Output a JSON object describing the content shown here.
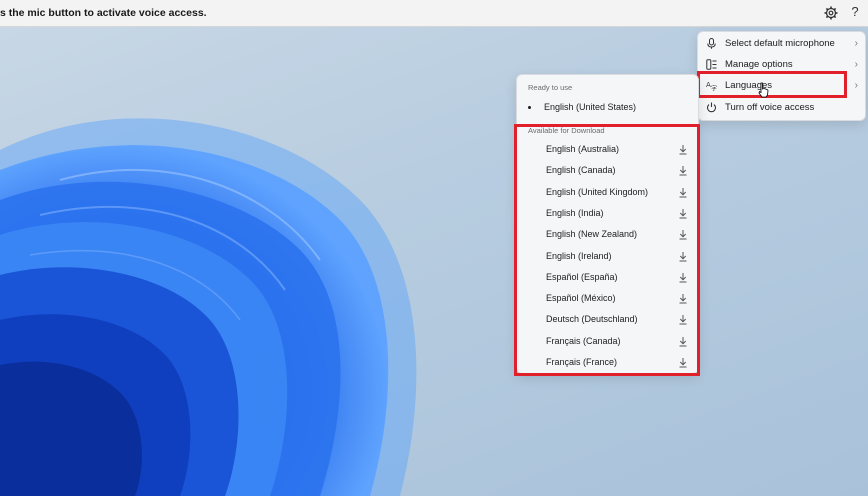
{
  "topbar": {
    "message": "s the mic button to activate voice access.",
    "gear_icon": "gear-icon",
    "help_label": "?"
  },
  "menu": {
    "items": [
      {
        "label": "Select default microphone",
        "icon": "microphone-icon",
        "has_submenu": true
      },
      {
        "label": "Manage options",
        "icon": "manage-options-icon",
        "has_submenu": true
      },
      {
        "label": "Languages",
        "icon": "language-icon",
        "has_submenu": true
      },
      {
        "label": "Turn off voice access",
        "icon": "power-icon",
        "has_submenu": false
      }
    ],
    "chevron": "›"
  },
  "languages_panel": {
    "ready_header": "Ready to use",
    "ready_items": [
      "English (United States)"
    ],
    "download_header": "Available for Download",
    "download_items": [
      "English (Australia)",
      "English (Canada)",
      "English (United Kingdom)",
      "English (India)",
      "English (New Zealand)",
      "English (Ireland)",
      "Español (España)",
      "Español (México)",
      "Deutsch (Deutschland)",
      "Français (Canada)",
      "Français (France)"
    ]
  },
  "colors": {
    "highlight": "#e0202a",
    "wallpaper_blue": "#1f63e6"
  }
}
